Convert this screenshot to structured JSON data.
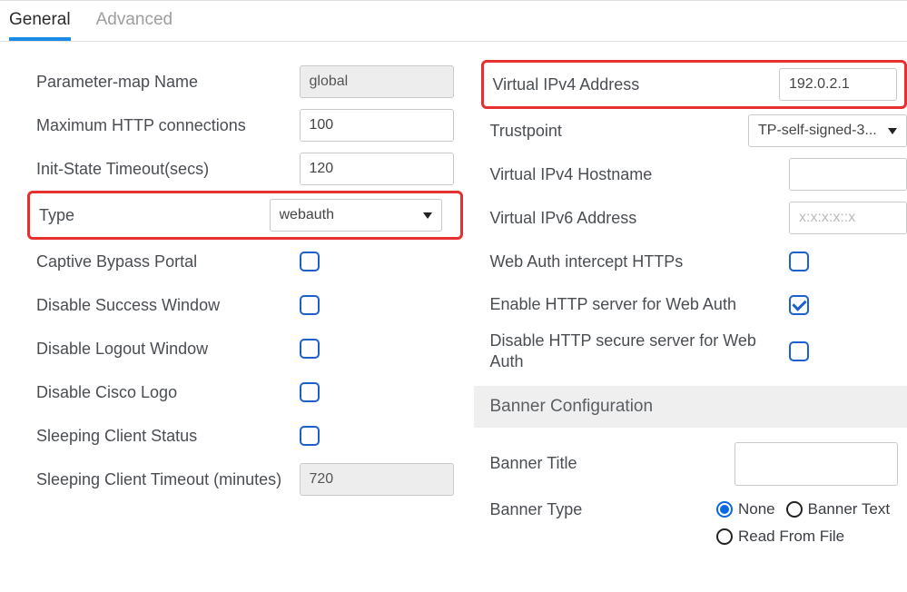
{
  "tabs": {
    "general": "General",
    "advanced": "Advanced"
  },
  "left": {
    "paramMapName": {
      "label": "Parameter-map Name",
      "value": "global"
    },
    "maxHttp": {
      "label": "Maximum HTTP connections",
      "value": "100"
    },
    "initState": {
      "label": "Init-State Timeout(secs)",
      "value": "120"
    },
    "type": {
      "label": "Type",
      "value": "webauth"
    },
    "captiveBypass": {
      "label": "Captive Bypass Portal",
      "checked": false
    },
    "disableSuccess": {
      "label": "Disable Success Window",
      "checked": false
    },
    "disableLogout": {
      "label": "Disable Logout Window",
      "checked": false
    },
    "disableCiscoLogo": {
      "label": "Disable Cisco Logo",
      "checked": false
    },
    "sleepingClientStatus": {
      "label": "Sleeping Client Status",
      "checked": false
    },
    "sleepingClientTimeout": {
      "label": "Sleeping Client Timeout (minutes)",
      "value": "720"
    }
  },
  "right": {
    "virtualIpv4": {
      "label": "Virtual IPv4 Address",
      "value": "192.0.2.1"
    },
    "trustpoint": {
      "label": "Trustpoint",
      "value": "TP-self-signed-3..."
    },
    "virtualIpv4Hostname": {
      "label": "Virtual IPv4 Hostname",
      "value": ""
    },
    "virtualIpv6": {
      "label": "Virtual IPv6 Address",
      "value": "",
      "placeholder": "x:x:x:x::x"
    },
    "webAuthInterceptHttps": {
      "label": "Web Auth intercept HTTPs",
      "checked": false
    },
    "enableHttpServerWebAuth": {
      "label": "Enable HTTP server for Web Auth",
      "checked": true
    },
    "disableHttpSecureServerWebAuth": {
      "label": "Disable HTTP secure server for Web Auth",
      "checked": false
    },
    "bannerConfigHeader": "Banner Configuration",
    "bannerTitle": {
      "label": "Banner Title",
      "value": ""
    },
    "bannerType": {
      "label": "Banner Type",
      "selected": "none",
      "options": {
        "none": "None",
        "bannerText": "Banner Text",
        "readFromFile": "Read From File"
      }
    }
  }
}
